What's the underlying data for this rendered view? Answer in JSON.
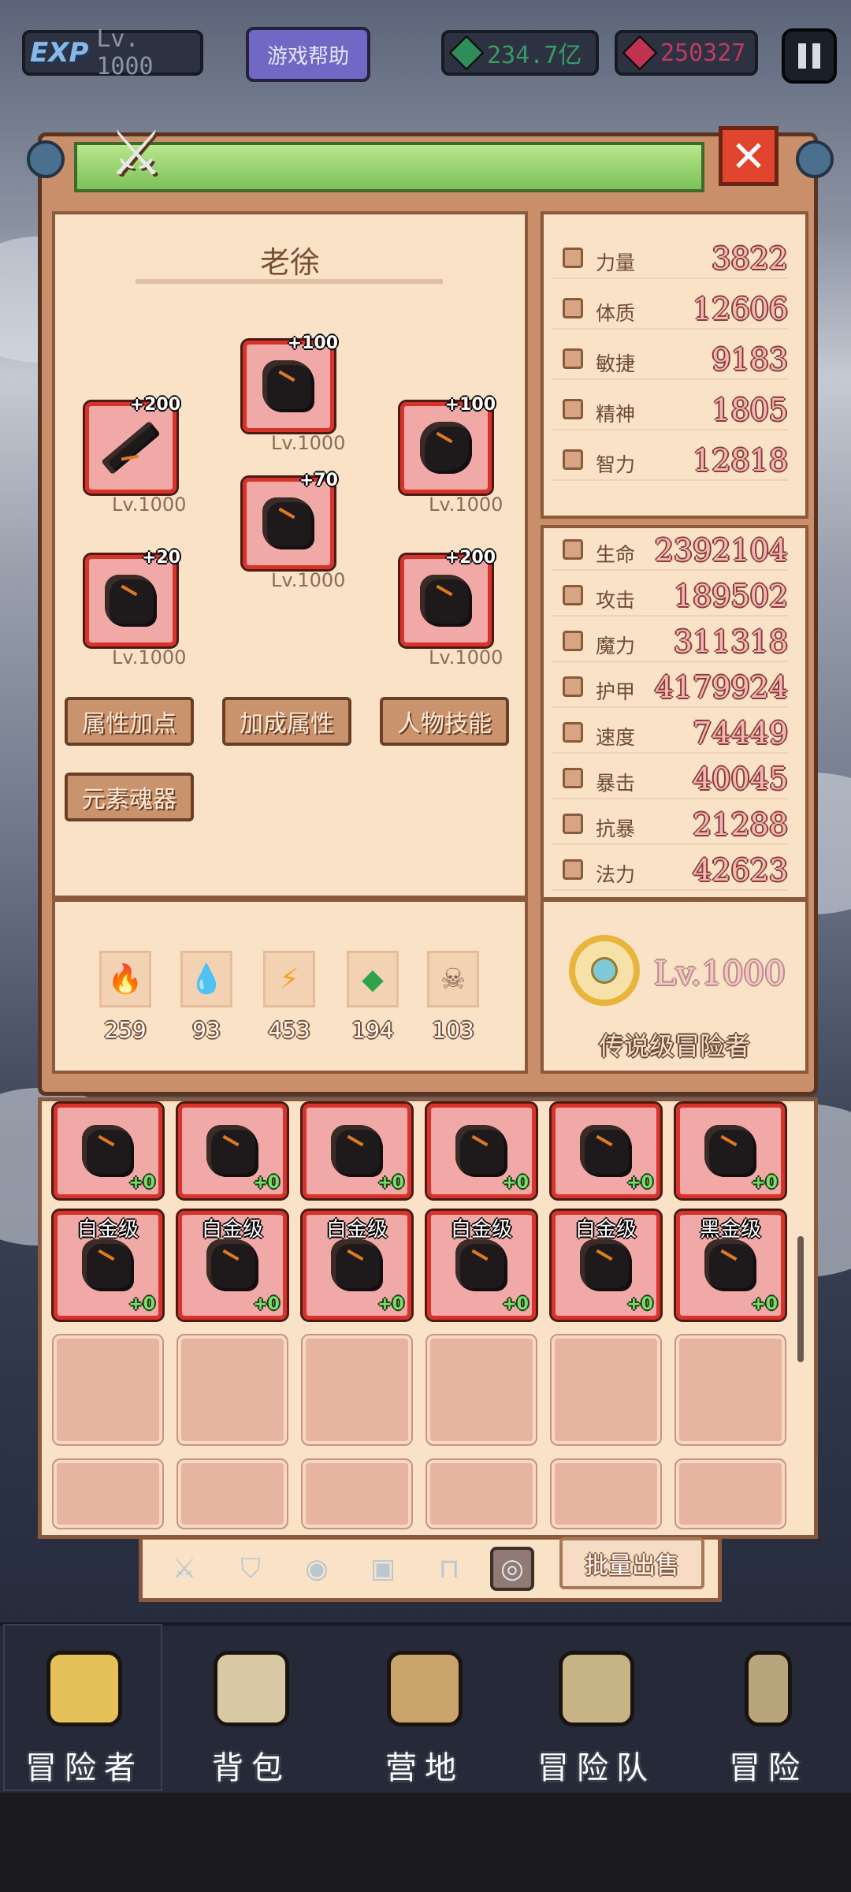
{
  "topbar": {
    "exp_label": "EXP",
    "level": "Lv. 1000",
    "help": "游戏帮助",
    "gems": "234.7亿",
    "rubies": "250327",
    "gem_color": "#2f8d5a",
    "ruby_color": "#c0324f"
  },
  "character": {
    "name": "老徐",
    "equipment": [
      {
        "slot": "weapon",
        "plus": "+200",
        "level": "Lv.1000"
      },
      {
        "slot": "helmet",
        "plus": "+100",
        "level": "Lv.1000"
      },
      {
        "slot": "shield",
        "plus": "+100",
        "level": "Lv.1000"
      },
      {
        "slot": "armor",
        "plus": "+70",
        "level": "Lv.1000"
      },
      {
        "slot": "gloves",
        "plus": "+20",
        "level": "Lv.1000"
      },
      {
        "slot": "boots",
        "plus": "+200",
        "level": "Lv.1000"
      }
    ],
    "buttons": [
      "属性加点",
      "加成属性",
      "人物技能",
      "元素魂器"
    ]
  },
  "base_stats": [
    {
      "label": "力量",
      "value": "3822"
    },
    {
      "label": "体质",
      "value": "12606"
    },
    {
      "label": "敏捷",
      "value": "9183"
    },
    {
      "label": "精神",
      "value": "1805"
    },
    {
      "label": "智力",
      "value": "12818"
    }
  ],
  "combat_stats": [
    {
      "label": "生命",
      "value": "2392104"
    },
    {
      "label": "攻击",
      "value": "189502"
    },
    {
      "label": "魔力",
      "value": "311318"
    },
    {
      "label": "护甲",
      "value": "4179924"
    },
    {
      "label": "速度",
      "value": "74449"
    },
    {
      "label": "暴击",
      "value": "40045"
    },
    {
      "label": "抗暴",
      "value": "21288"
    },
    {
      "label": "法力",
      "value": "42623"
    }
  ],
  "elements": [
    {
      "name": "fire",
      "count": "259"
    },
    {
      "name": "water",
      "count": "93"
    },
    {
      "name": "lightning",
      "count": "453"
    },
    {
      "name": "nature",
      "count": "194"
    },
    {
      "name": "dark",
      "count": "103"
    }
  ],
  "rank": {
    "level": "Lv.1000",
    "title": "传说级冒险者"
  },
  "inventory": {
    "row1": [
      {
        "grade": "",
        "plus": "+0"
      },
      {
        "grade": "",
        "plus": "+0"
      },
      {
        "grade": "",
        "plus": "+0"
      },
      {
        "grade": "",
        "plus": "+0"
      },
      {
        "grade": "",
        "plus": "+0"
      },
      {
        "grade": "",
        "plus": "+0"
      }
    ],
    "row2": [
      {
        "grade": "白金级",
        "plus": "+0"
      },
      {
        "grade": "白金级",
        "plus": "+0"
      },
      {
        "grade": "白金级",
        "plus": "+0"
      },
      {
        "grade": "白金级",
        "plus": "+0"
      },
      {
        "grade": "白金级",
        "plus": "+0"
      },
      {
        "grade": "黑金级",
        "plus": "+0"
      }
    ]
  },
  "category_tabs": [
    "sword-icon",
    "shield-icon",
    "helmet-icon",
    "armor-icon",
    "boots-icon",
    "ring-icon"
  ],
  "bulk_sell": "批量出售",
  "nav": [
    {
      "label": "冒险者",
      "icon": "crown-icon"
    },
    {
      "label": "背包",
      "icon": "backpack-icon"
    },
    {
      "label": "营地",
      "icon": "camp-icon"
    },
    {
      "label": "冒险队",
      "icon": "book-icon"
    },
    {
      "label": "冒险",
      "icon": "sword-icon"
    }
  ]
}
